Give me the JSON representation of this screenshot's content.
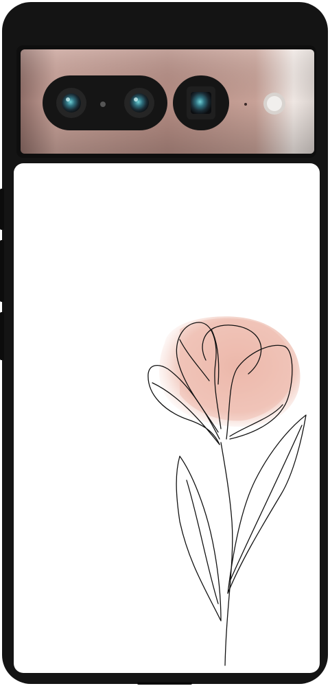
{
  "product": {
    "case_color": "#141414",
    "back_color": "#ffffff",
    "camera_bar_color": "#b58d84",
    "flower": {
      "petal_color": "#f0c7bc",
      "line_color": "#111111"
    }
  }
}
